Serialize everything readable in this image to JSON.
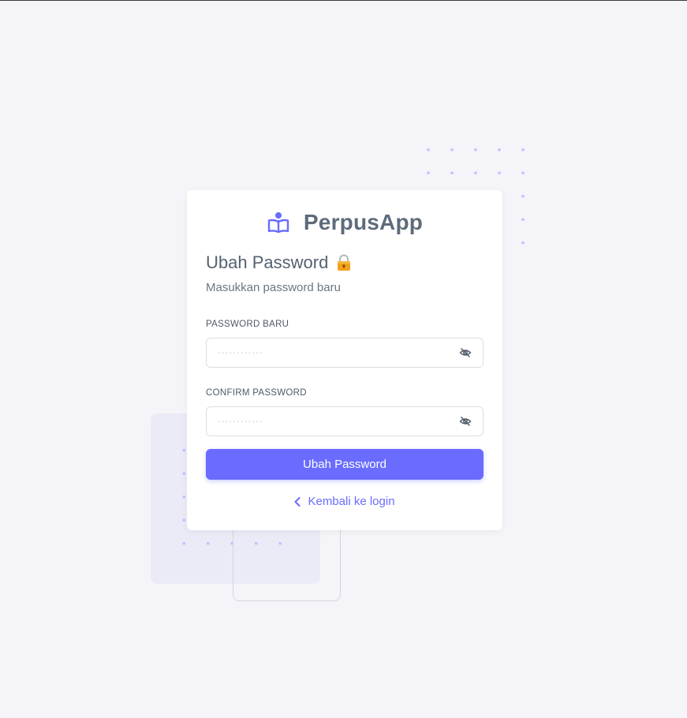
{
  "brand": {
    "name": "PerpusApp",
    "icon": "book-reader-icon",
    "accent_color": "#696cff"
  },
  "form": {
    "title": "Ubah Password",
    "title_emoji": "lock-icon",
    "subtitle": "Masukkan password baru",
    "new_password": {
      "label": "PASSWORD BARU",
      "placeholder": "············",
      "icon": "eye-off-icon"
    },
    "confirm_password": {
      "label": "CONFIRM PASSWORD",
      "placeholder": "············",
      "icon": "eye-off-icon"
    },
    "submit_label": "Ubah Password",
    "back_link": {
      "label": "Kembali ke login",
      "icon": "chevron-left-icon"
    }
  }
}
